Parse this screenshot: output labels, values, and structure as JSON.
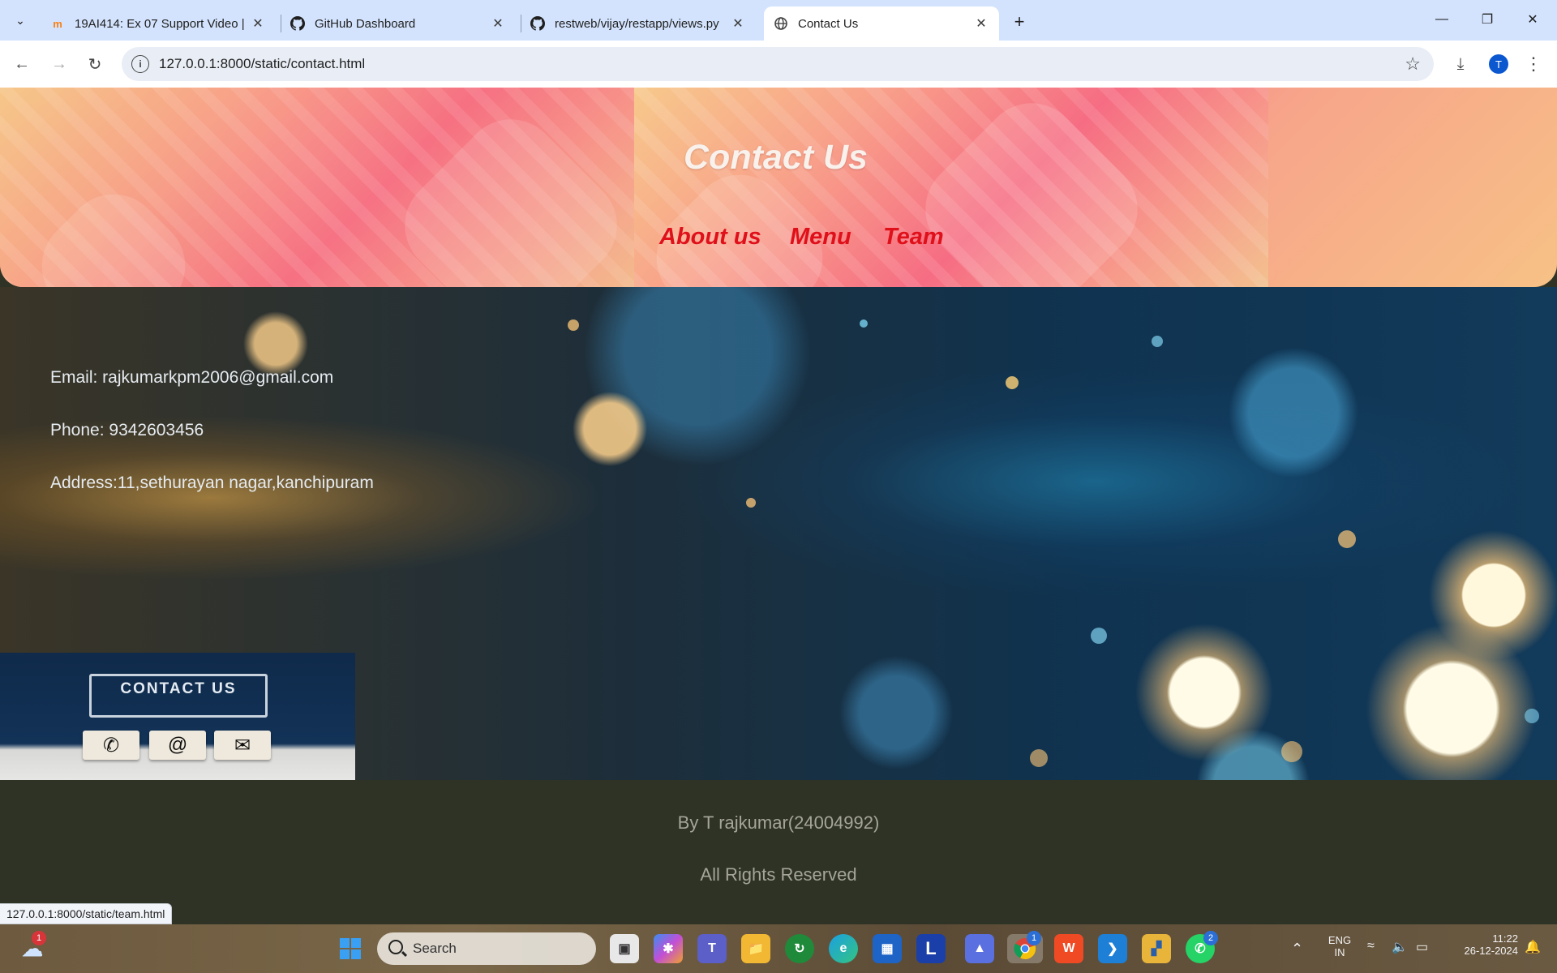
{
  "browser": {
    "tabs": [
      {
        "title": "19AI414: Ex 07 Support Video |",
        "icon": "moodle-icon"
      },
      {
        "title": "GitHub Dashboard",
        "icon": "github-icon"
      },
      {
        "title": "restweb/vijay/restapp/views.py",
        "icon": "github-icon"
      },
      {
        "title": "Contact Us",
        "icon": "globe-icon",
        "active": true
      }
    ],
    "url": "127.0.0.1:8000/static/contact.html",
    "profile_initial": "T",
    "status_url": "127.0.0.1:8000/static/team.html"
  },
  "page": {
    "header_title": "Contact Us",
    "nav": [
      "About us",
      "Menu",
      "Team"
    ],
    "contact": {
      "email": "Email: rajkumarkpm2006@gmail.com",
      "phone": "Phone: 9342603456",
      "address": "Address:11,sethurayan nagar,kanchipuram"
    },
    "image_sign": "CONTACT US",
    "footer": {
      "credit": "By T rajkumar(24004992)",
      "rights": "All Rights Reserved"
    },
    "colors": {
      "nav_link": "#e0101a",
      "footer_bg": "#2e3326",
      "footer_text": "#a6a59a"
    }
  },
  "taskbar": {
    "search_placeholder": "Search",
    "weather_badge": "1",
    "chrome_badge": "1",
    "whatsapp_badge": "2",
    "language": "ENG",
    "region": "IN",
    "time": "11:22",
    "date": "26-12-2024"
  }
}
